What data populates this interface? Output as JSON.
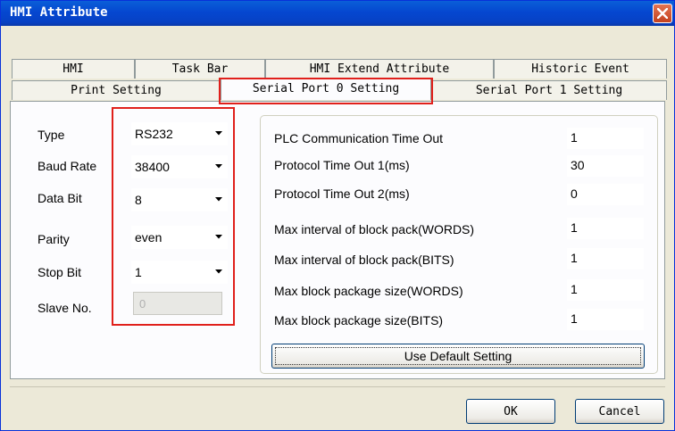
{
  "window": {
    "title": "HMI Attribute"
  },
  "tabs_row1": [
    "HMI",
    "Task Bar",
    "HMI Extend Attribute",
    "Historic Event"
  ],
  "tabs_row2": [
    "Print Setting",
    "Serial Port 0 Setting",
    "Serial Port 1 Setting"
  ],
  "active_tab": "Serial Port 0 Setting",
  "port": {
    "type": {
      "label": "Type",
      "value": "RS232"
    },
    "baud_rate": {
      "label": "Baud Rate",
      "value": "38400"
    },
    "data_bit": {
      "label": "Data Bit",
      "value": "8"
    },
    "parity": {
      "label": "Parity",
      "value": "even"
    },
    "stop_bit": {
      "label": "Stop Bit",
      "value": "1"
    },
    "slave_no": {
      "label": "Slave No.",
      "value": "0"
    }
  },
  "timing": [
    {
      "label": "PLC Communication Time Out",
      "value": "1"
    },
    {
      "label": "Protocol Time Out 1(ms)",
      "value": "30"
    },
    {
      "label": "Protocol Time Out 2(ms)",
      "value": "0"
    },
    {
      "label": "Max interval of block pack(WORDS)",
      "value": "1"
    },
    {
      "label": "Max interval of block pack(BITS)",
      "value": "1"
    },
    {
      "label": "Max block package size(WORDS)",
      "value": "1"
    },
    {
      "label": "Max block package size(BITS)",
      "value": "1"
    }
  ],
  "buttons": {
    "use_default": "Use Default Setting",
    "ok": "OK",
    "cancel": "Cancel"
  },
  "colors": {
    "title_bar": "#0547d0",
    "highlight_box": "#e0201b",
    "dialog_bg": "#ece9d8",
    "close_button": "#c3411e"
  },
  "icons": {
    "close": "close-icon",
    "dropdown": "chevron-down-icon"
  }
}
